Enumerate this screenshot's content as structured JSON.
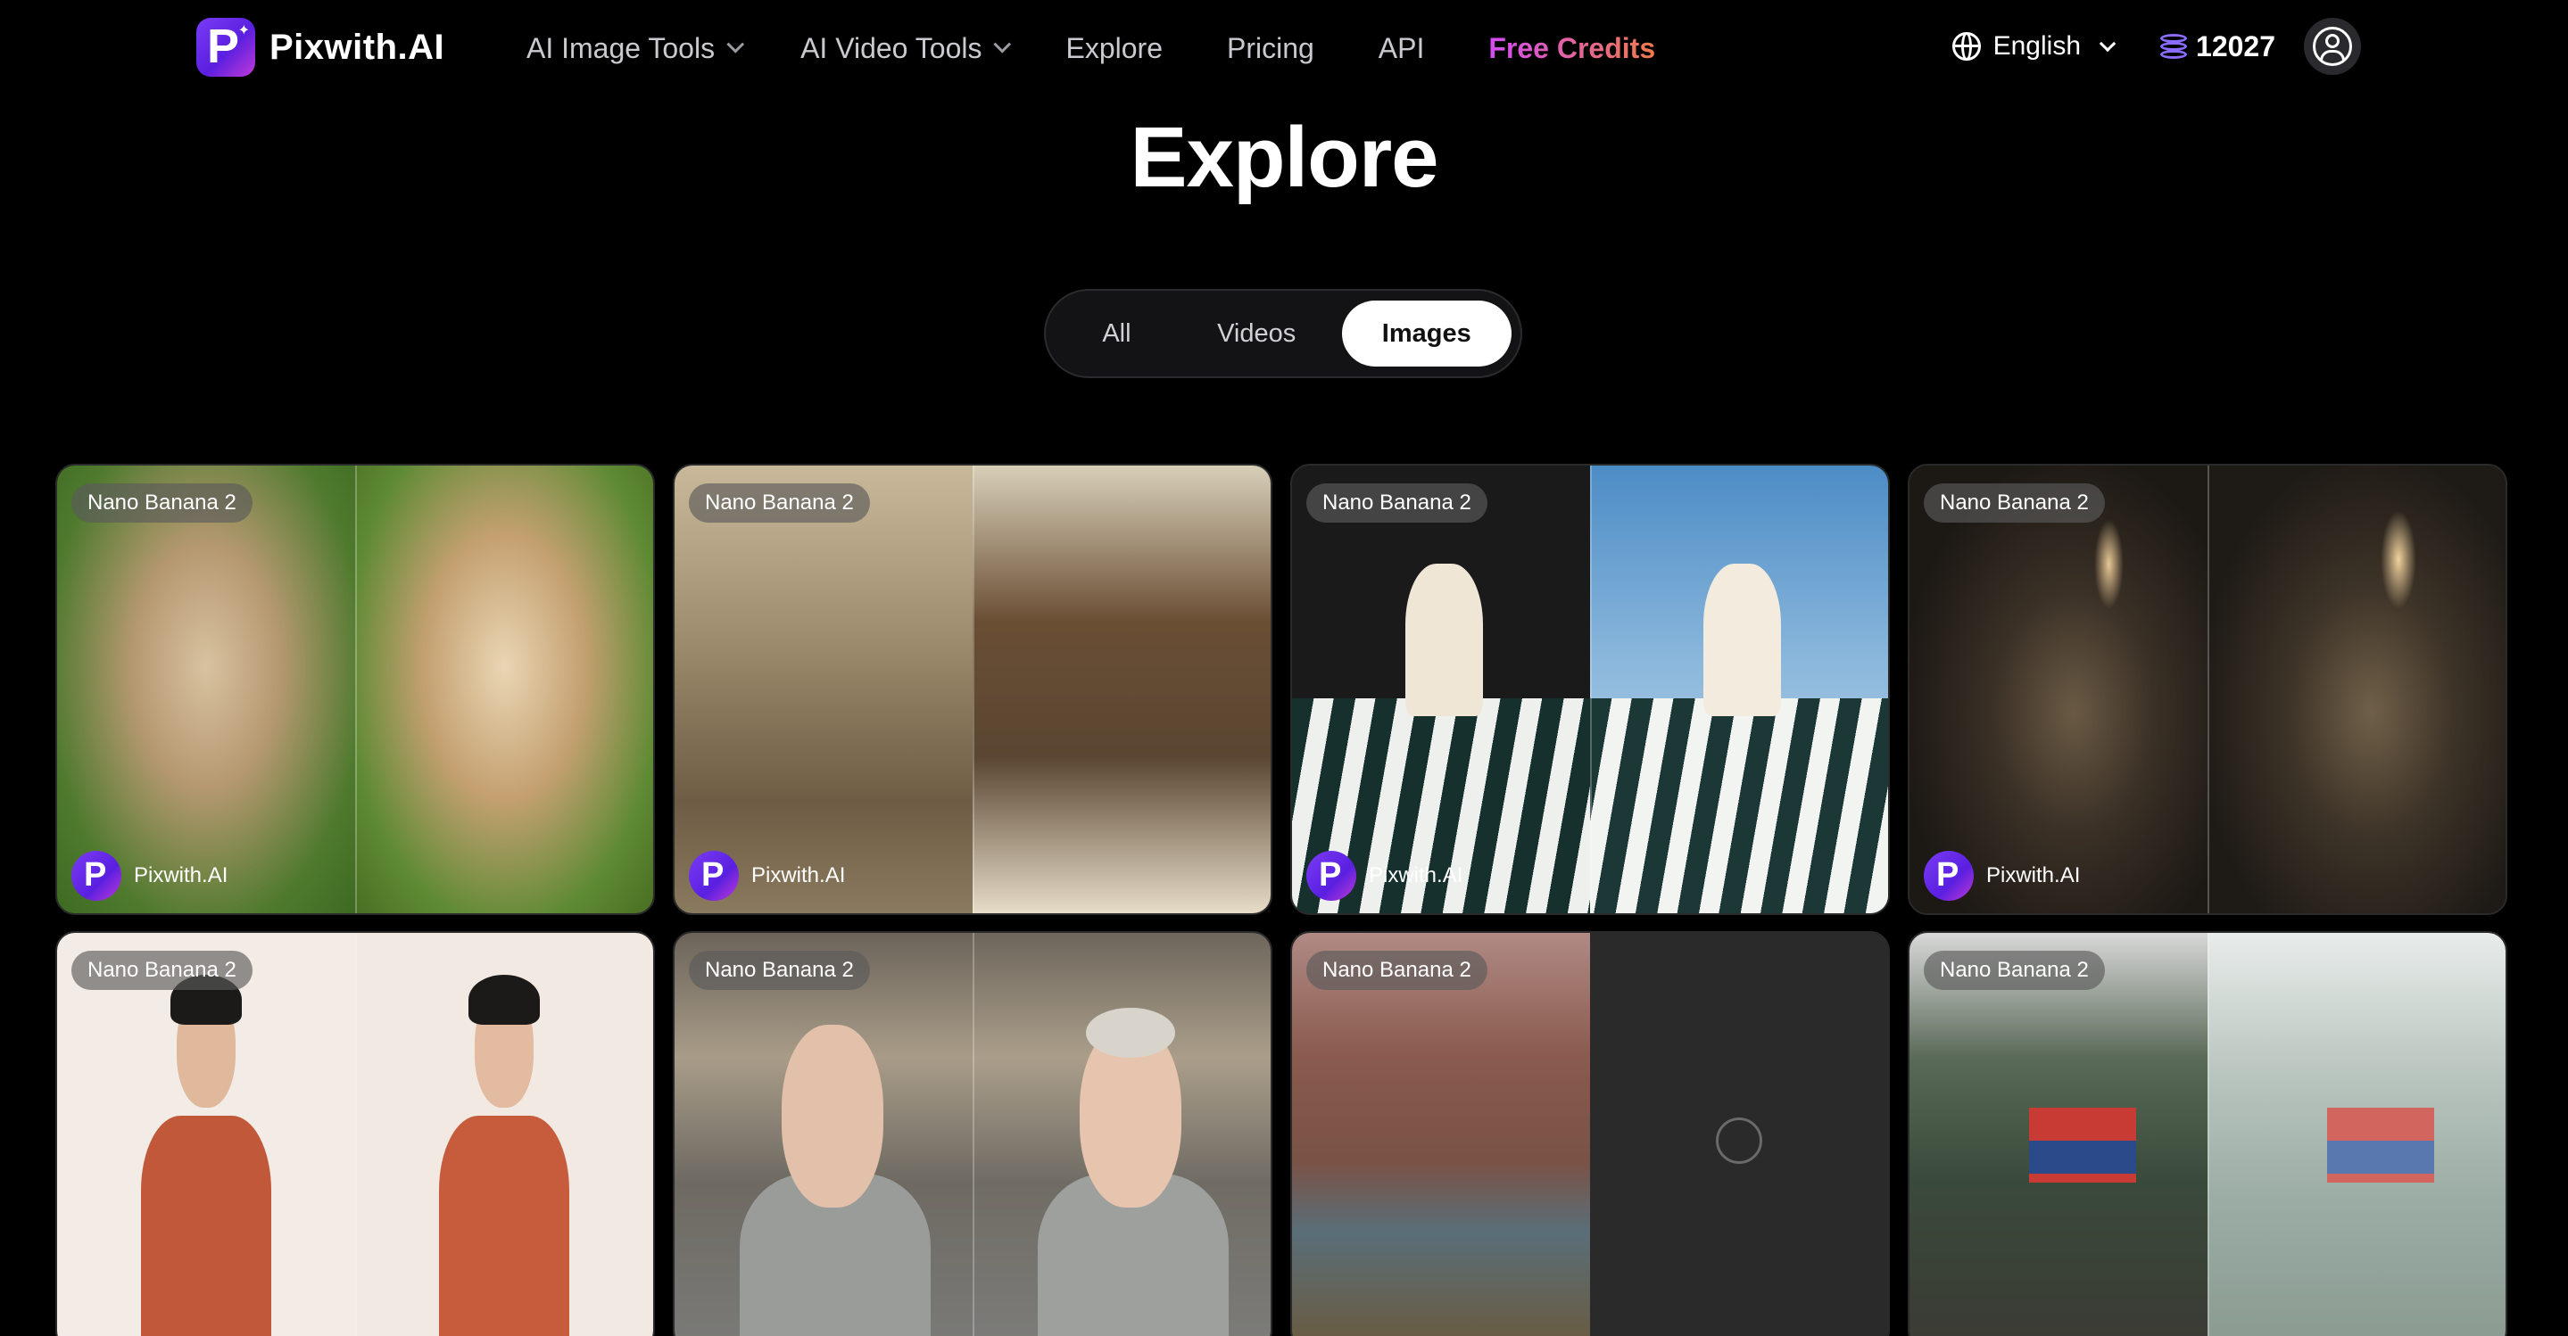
{
  "brand": {
    "name": "Pixwith.AI"
  },
  "nav": {
    "items": [
      {
        "label": "AI Image Tools",
        "dropdown": true
      },
      {
        "label": "AI Video Tools",
        "dropdown": true
      },
      {
        "label": "Explore",
        "dropdown": false
      },
      {
        "label": "Pricing",
        "dropdown": false
      },
      {
        "label": "API",
        "dropdown": false
      },
      {
        "label": "Free Credits",
        "dropdown": false,
        "accent": "#e158c8"
      }
    ]
  },
  "header_right": {
    "language": "English",
    "credits": "12027",
    "icons": [
      "globe-icon",
      "chevron-down-icon",
      "credits-coin-icon",
      "user-avatar-icon"
    ]
  },
  "page": {
    "title": "Explore"
  },
  "tabs": [
    {
      "label": "All",
      "active": false
    },
    {
      "label": "Videos",
      "active": false
    },
    {
      "label": "Images",
      "active": true
    }
  ],
  "cards": [
    {
      "model": "Nano Banana 2",
      "author": "Pixwith.AI",
      "subject": "puppy-restoration",
      "left_color": "#8a8a50",
      "right_color": "#a89060",
      "loading": false
    },
    {
      "model": "Nano Banana 2",
      "author": "Pixwith.AI",
      "subject": "vintage-couple-colorize",
      "left_color": "#9a8a6e",
      "right_color": "#6e5a44",
      "loading": false
    },
    {
      "model": "Nano Banana 2",
      "author": "Pixwith.AI",
      "subject": "woman-striped-bag",
      "left_color": "#4a82b8",
      "right_color": "#6fa0c8",
      "loading": false
    },
    {
      "model": "Nano Banana 2",
      "author": "Pixwith.AI",
      "subject": "woman-dark-room",
      "left_color": "#2a2420",
      "right_color": "#2e2822",
      "loading": false
    },
    {
      "model": "Nano Banana 2",
      "author": "",
      "subject": "person-red-cardigan",
      "left_color": "#efe8e2",
      "right_color": "#eee6df",
      "loading": false
    },
    {
      "model": "Nano Banana 2",
      "author": "",
      "subject": "older-man-office",
      "left_color": "#8a8478",
      "right_color": "#8e887c",
      "loading": false
    },
    {
      "model": "Nano Banana 2",
      "author": "",
      "subject": "canyon-river",
      "left_color": "#8a5a4e",
      "right_color": "#2a2a2a",
      "loading": true
    },
    {
      "model": "Nano Banana 2",
      "author": "",
      "subject": "train-street-painting",
      "left_color": "#4a5a48",
      "right_color": "#a8b4ae",
      "loading": false
    }
  ]
}
